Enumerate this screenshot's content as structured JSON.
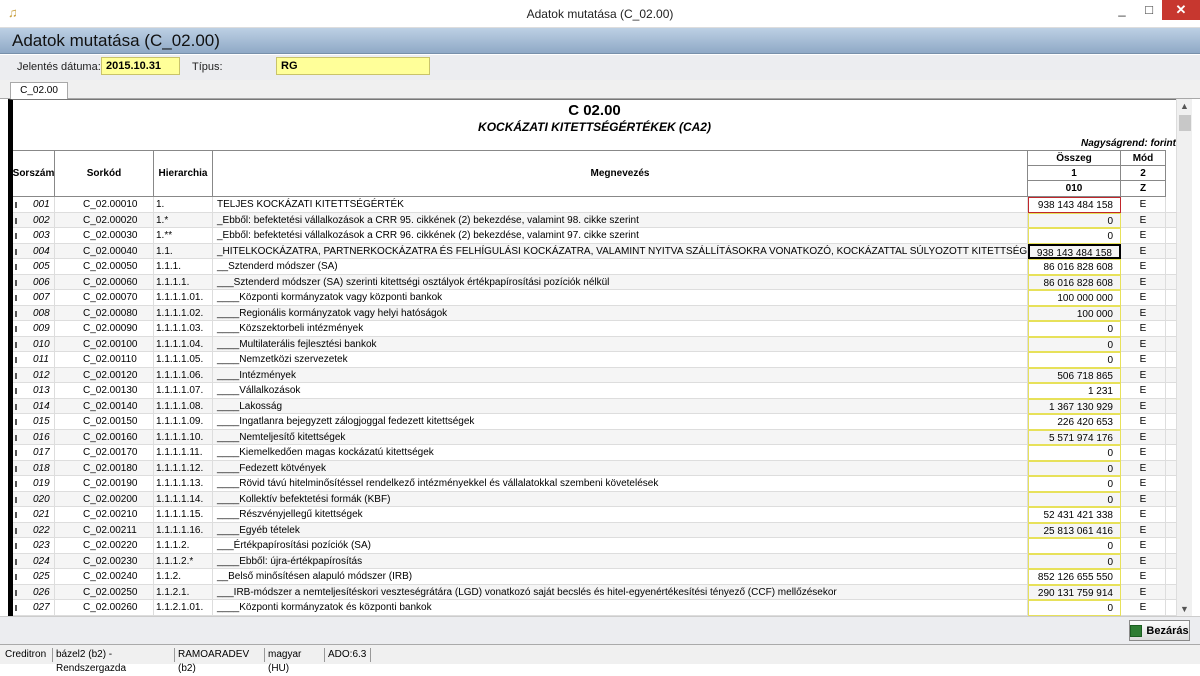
{
  "window": {
    "title": "Adatok mutatása (C_02.00)",
    "minimize": "_",
    "maximize": "□",
    "close": "✕",
    "icon": "app-icon"
  },
  "header": {
    "title": "Adatok mutatása (C_02.00)"
  },
  "form": {
    "date_label": "Jelentés dátuma:",
    "date_value": "2015.10.31",
    "type_label": "Típus:",
    "type_value": "RG"
  },
  "tab": {
    "label": "C_02.00"
  },
  "report": {
    "code": "C  02.00",
    "title": "KOCKÁZATI KITETTSÉGÉRTÉKEK (CA2)",
    "magnitude": "Nagyságrend: forint",
    "columns": {
      "sorszam": "Sorszám",
      "sorkod": "Sorkód",
      "hierarchia": "Hierarchia",
      "megnevezes": "Megnevezés",
      "osszeg": "Összeg",
      "osszeg_num": "1",
      "osszeg_code": "010",
      "mod": "Mód",
      "mod_num": "2",
      "mod_code": "Z"
    },
    "rows": [
      {
        "sz": "001",
        "sk": "C_02.00010",
        "hi": "1.",
        "me": "TELJES KOCKÁZATI KITETTSÉGÉRTÉK",
        "os": "938 143 484 158",
        "mo": "E",
        "st": "red"
      },
      {
        "sz": "002",
        "sk": "C_02.00020",
        "hi": "1.*",
        "me": "_Ebből: befektetési vállalkozások a CRR 95. cikkének (2) bekezdése, valamint 98. cikke szerint",
        "os": "0",
        "mo": "E",
        "st": ""
      },
      {
        "sz": "003",
        "sk": "C_02.00030",
        "hi": "1.**",
        "me": "_Ebből: befektetési vállalkozások a CRR 96. cikkének (2) bekezdése, valamint 97. cikke szerint",
        "os": "0",
        "mo": "E",
        "st": ""
      },
      {
        "sz": "004",
        "sk": "C_02.00040",
        "hi": "1.1.",
        "me": "_HITELKOCKÁZATRA, PARTNERKOCKÁZATRA ÉS FELHÍGULÁSI KOCKÁZATRA, VALAMINT NYITVA SZÁLLÍTÁSOKRA VONATKOZÓ, KOCKÁZATTAL SÚLYOZOTT KITETTSÉGÉRTÉKE",
        "os": "938 143 484 158",
        "mo": "E",
        "st": "blk"
      },
      {
        "sz": "005",
        "sk": "C_02.00050",
        "hi": "1.1.1.",
        "me": "__Sztenderd módszer (SA)",
        "os": "86 016 828 608",
        "mo": "E",
        "st": ""
      },
      {
        "sz": "006",
        "sk": "C_02.00060",
        "hi": "1.1.1.1.",
        "me": "___Sztenderd módszer (SA) szerinti kitettségi osztályok értékpapírosítási pozíciók nélkül",
        "os": "86 016 828 608",
        "mo": "E",
        "st": ""
      },
      {
        "sz": "007",
        "sk": "C_02.00070",
        "hi": "1.1.1.1.01.",
        "me": "____Központi kormányzatok vagy központi bankok",
        "os": "100 000 000",
        "mo": "E",
        "st": ""
      },
      {
        "sz": "008",
        "sk": "C_02.00080",
        "hi": "1.1.1.1.02.",
        "me": "____Regionális kormányzatok vagy helyi hatóságok",
        "os": "100 000",
        "mo": "E",
        "st": ""
      },
      {
        "sz": "009",
        "sk": "C_02.00090",
        "hi": "1.1.1.1.03.",
        "me": "____Közszektorbeli intézmények",
        "os": "0",
        "mo": "E",
        "st": ""
      },
      {
        "sz": "010",
        "sk": "C_02.00100",
        "hi": "1.1.1.1.04.",
        "me": "____Multilaterális fejlesztési bankok",
        "os": "0",
        "mo": "E",
        "st": ""
      },
      {
        "sz": "011",
        "sk": "C_02.00110",
        "hi": "1.1.1.1.05.",
        "me": "____Nemzetközi szervezetek",
        "os": "0",
        "mo": "E",
        "st": ""
      },
      {
        "sz": "012",
        "sk": "C_02.00120",
        "hi": "1.1.1.1.06.",
        "me": "____Intézmények",
        "os": "506 718 865",
        "mo": "E",
        "st": ""
      },
      {
        "sz": "013",
        "sk": "C_02.00130",
        "hi": "1.1.1.1.07.",
        "me": "____Vállalkozások",
        "os": "1 231",
        "mo": "E",
        "st": ""
      },
      {
        "sz": "014",
        "sk": "C_02.00140",
        "hi": "1.1.1.1.08.",
        "me": "____Lakosság",
        "os": "1 367 130 929",
        "mo": "E",
        "st": ""
      },
      {
        "sz": "015",
        "sk": "C_02.00150",
        "hi": "1.1.1.1.09.",
        "me": "____Ingatlanra bejegyzett zálogjoggal fedezett kitettségek",
        "os": "226 420 653",
        "mo": "E",
        "st": ""
      },
      {
        "sz": "016",
        "sk": "C_02.00160",
        "hi": "1.1.1.1.10.",
        "me": "____Nemteljesítő kitettségek",
        "os": "5 571 974 176",
        "mo": "E",
        "st": ""
      },
      {
        "sz": "017",
        "sk": "C_02.00170",
        "hi": "1.1.1.1.11.",
        "me": "____Kiemelkedően magas kockázatú kitettségek",
        "os": "0",
        "mo": "E",
        "st": ""
      },
      {
        "sz": "018",
        "sk": "C_02.00180",
        "hi": "1.1.1.1.12.",
        "me": "____Fedezett kötvények",
        "os": "0",
        "mo": "E",
        "st": ""
      },
      {
        "sz": "019",
        "sk": "C_02.00190",
        "hi": "1.1.1.1.13.",
        "me": "____Rövid távú hitelminősítéssel rendelkező intézményekkel és vállalatokkal szembeni követelések",
        "os": "0",
        "mo": "E",
        "st": ""
      },
      {
        "sz": "020",
        "sk": "C_02.00200",
        "hi": "1.1.1.1.14.",
        "me": "____Kollektív befektetési formák (KBF)",
        "os": "0",
        "mo": "E",
        "st": ""
      },
      {
        "sz": "021",
        "sk": "C_02.00210",
        "hi": "1.1.1.1.15.",
        "me": "____Részvényjellegű kitettségek",
        "os": "52 431 421 338",
        "mo": "E",
        "st": ""
      },
      {
        "sz": "022",
        "sk": "C_02.00211",
        "hi": "1.1.1.1.16.",
        "me": "____Egyéb tételek",
        "os": "25 813 061 416",
        "mo": "E",
        "st": ""
      },
      {
        "sz": "023",
        "sk": "C_02.00220",
        "hi": "1.1.1.2.",
        "me": "___Értékpapírosítási pozíciók (SA)",
        "os": "0",
        "mo": "E",
        "st": ""
      },
      {
        "sz": "024",
        "sk": "C_02.00230",
        "hi": "1.1.1.2.*",
        "me": "____Ebből: újra-értékpapírosítás",
        "os": "0",
        "mo": "E",
        "st": ""
      },
      {
        "sz": "025",
        "sk": "C_02.00240",
        "hi": "1.1.2.",
        "me": "__Belső minősítésen alapuló módszer (IRB)",
        "os": "852 126 655 550",
        "mo": "E",
        "st": ""
      },
      {
        "sz": "026",
        "sk": "C_02.00250",
        "hi": "1.1.2.1.",
        "me": "___IRB-módszer a nemteljesítéskori veszteségrátára (LGD) vonatkozó saját becslés és hitel-egyenértékesítési tényező (CCF) mellőzésekor",
        "os": "290 131 759 914",
        "mo": "E",
        "st": ""
      },
      {
        "sz": "027",
        "sk": "C_02.00260",
        "hi": "1.1.2.1.01.",
        "me": "____Központi kormányzatok és központi bankok",
        "os": "0",
        "mo": "E",
        "st": ""
      }
    ]
  },
  "buttons": {
    "close": "Bezárás"
  },
  "statusbar": {
    "app": "Creditron",
    "db": "bázel2 (b2) - Rendszergazda",
    "user": "RAMOARADEV (b2)",
    "lang": "magyar (HU)",
    "ado": "ADO:6.3"
  }
}
